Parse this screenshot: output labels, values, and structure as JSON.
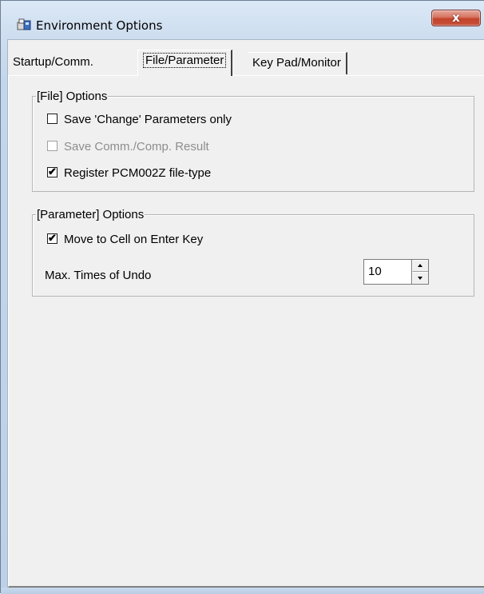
{
  "window": {
    "title": "Environment Options",
    "close_label": "x"
  },
  "tabs": [
    {
      "label": "Startup/Comm.",
      "selected": false
    },
    {
      "label": "File/Parameter",
      "selected": true
    },
    {
      "label": "Key Pad/Monitor",
      "selected": false
    }
  ],
  "file_options": {
    "legend": "[File] Options",
    "items": [
      {
        "label": "Save 'Change' Parameters only",
        "checked": false,
        "enabled": true
      },
      {
        "label": "Save Comm./Comp. Result",
        "checked": false,
        "enabled": false
      },
      {
        "label": "Register PCM002Z file-type",
        "checked": true,
        "enabled": true
      }
    ]
  },
  "parameter_options": {
    "legend": "[Parameter] Options",
    "move_to_cell": {
      "label": "Move to Cell on Enter Key",
      "checked": true
    },
    "undo": {
      "label": "Max. Times of Undo",
      "value": "10"
    }
  },
  "check_mark": "✔"
}
